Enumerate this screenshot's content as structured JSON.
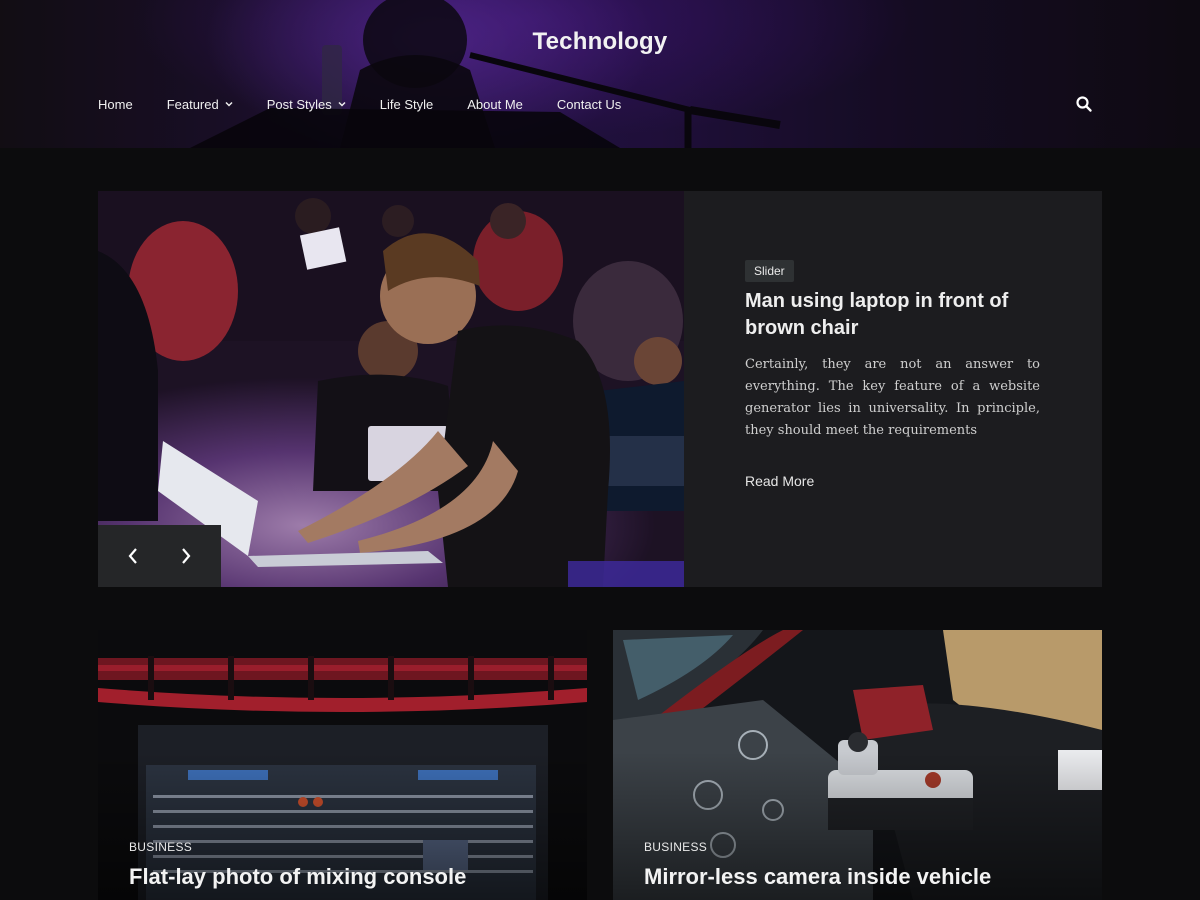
{
  "site": {
    "title": "Technology"
  },
  "nav": {
    "items": [
      {
        "label": "Home"
      },
      {
        "label": "Featured"
      },
      {
        "label": "Post Styles"
      },
      {
        "label": "Life Style"
      },
      {
        "label": "About Me"
      },
      {
        "label": "Contact Us"
      }
    ]
  },
  "slider": {
    "tag": "Slider",
    "title": "Man using laptop in front of brown chair",
    "excerpt": "Certainly, they are not an answer to everything. The key feature of a website generator lies in universality. In principle, they should meet the requirements",
    "read_more": "Read More"
  },
  "posts": [
    {
      "category": "BUSINESS",
      "title": "Flat-lay photo of mixing console"
    },
    {
      "category": "BUSINESS",
      "title": "Mirror-less camera inside vehicle"
    }
  ],
  "icons": {
    "search": "search-icon",
    "prev": "chevron-left-icon",
    "next": "chevron-right-icon",
    "dropdown": "chevron-down-icon"
  }
}
